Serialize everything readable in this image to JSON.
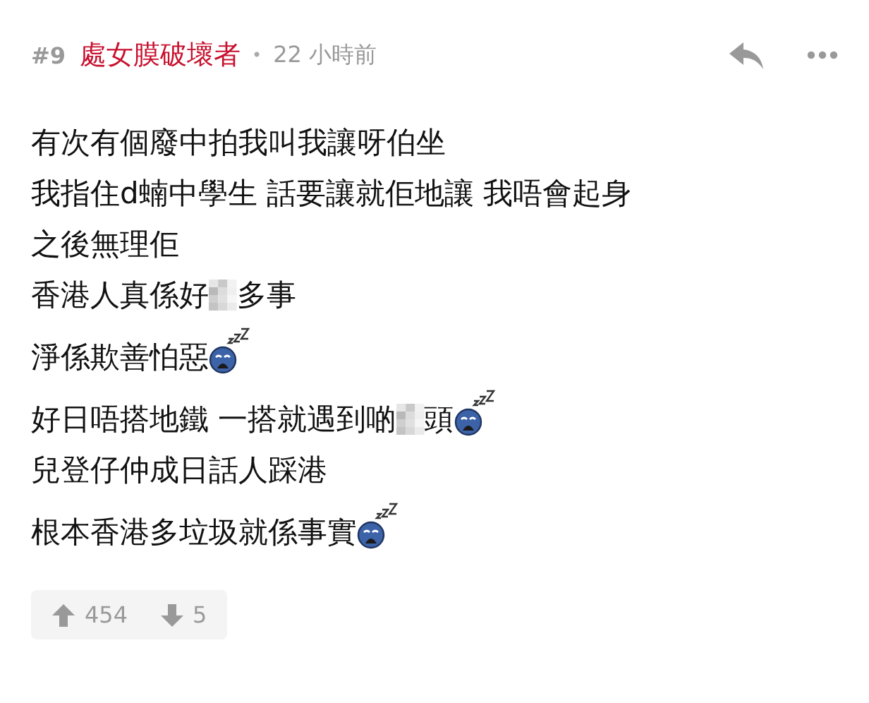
{
  "post": {
    "number": "#9",
    "author": "處女膜破壞者",
    "separator": "•",
    "time": "22 小時前"
  },
  "lines": [
    {
      "segments": [
        {
          "kind": "text",
          "text": "有次有個廢中拍我叫我讓呀伯坐"
        }
      ]
    },
    {
      "segments": [
        {
          "kind": "text",
          "text": "我指住d蝻中學生 話要讓就佢地讓 我唔會起身"
        }
      ]
    },
    {
      "segments": [
        {
          "kind": "text",
          "text": "之後無理佢"
        }
      ]
    },
    {
      "segments": [
        {
          "kind": "text",
          "text": "香港人真係好"
        },
        {
          "kind": "blur"
        },
        {
          "kind": "text",
          "text": "多事"
        }
      ]
    },
    {
      "segments": [
        {
          "kind": "text",
          "text": "淨係欺善怕惡"
        },
        {
          "kind": "emoji"
        }
      ]
    },
    {
      "segments": [
        {
          "kind": "text",
          "text": "好日唔搭地鐵 一搭就遇到啲"
        },
        {
          "kind": "blur"
        },
        {
          "kind": "text",
          "text": "頭"
        },
        {
          "kind": "emoji"
        }
      ]
    },
    {
      "segments": [
        {
          "kind": "text",
          "text": "兒登仔仲成日話人踩港"
        }
      ]
    },
    {
      "segments": [
        {
          "kind": "text",
          "text": "根本香港多垃圾就係事實"
        },
        {
          "kind": "emoji"
        }
      ]
    }
  ],
  "votes": {
    "up": "454",
    "down": "5"
  }
}
